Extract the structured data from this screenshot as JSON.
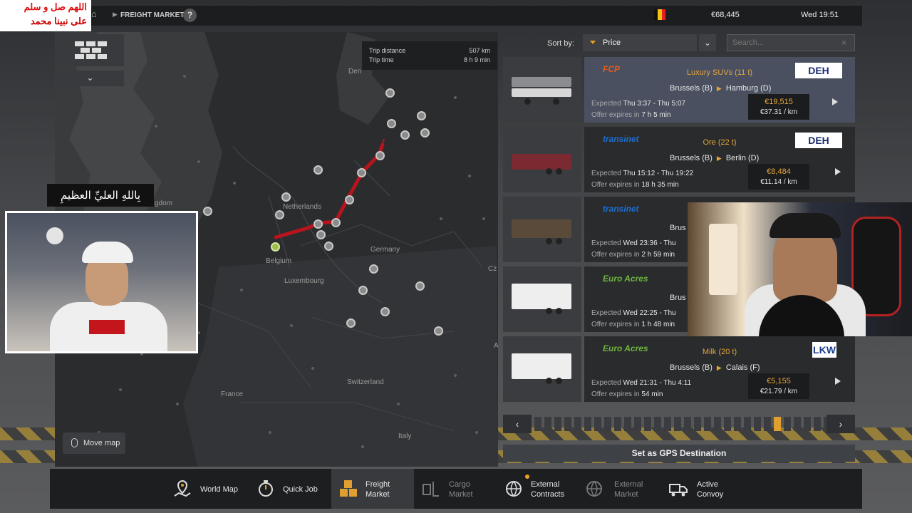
{
  "header": {
    "breadcrumb": "FREIGHT MARKET",
    "help": "?",
    "money": "€68,445",
    "clock": "Wed 19:51",
    "flag_colors": [
      "#111111",
      "#f3c30c",
      "#e61e25"
    ]
  },
  "overlay": {
    "arabic_line1": "اللهم صل و سلم",
    "arabic_line2": "على نبينا محمد",
    "caption": "بِاللهِ العليِّ العظيمِ"
  },
  "map": {
    "trip_distance_label": "Trip distance",
    "trip_distance_value": "507 km",
    "trip_time_label": "Trip time",
    "trip_time_value": "8 h 9 min",
    "labels": [
      "Den",
      "gdom",
      "Netherlands",
      "Belgium",
      "Luxembourg",
      "Germany",
      "Cz",
      "France",
      "Switzerland",
      "Italy",
      "A"
    ],
    "move_map": "Move map",
    "route_color": "#b8141e"
  },
  "sort": {
    "label": "Sort by:",
    "value": "Price",
    "search_placeholder": "Search..."
  },
  "jobs": [
    {
      "company": "FCP",
      "cargo": "Luxury SUVs (11 t)",
      "from": "Brussels (B)",
      "to": "Hamburg (D)",
      "expected_label": "Expected",
      "expected": "Thu 3:37 - Thu 5:07",
      "offer_label": "Offer expires in",
      "offer": "7 h 5 min",
      "price": "€19,515",
      "per_km": "€37.31 / km",
      "client": "DEH",
      "company_color": "#e85a16"
    },
    {
      "company": "transinet",
      "cargo": "Ore (22 t)",
      "from": "Brussels (B)",
      "to": "Berlin (D)",
      "expected_label": "Expected",
      "expected": "Thu 15:12 - Thu 19:22",
      "offer_label": "Offer expires in",
      "offer": "18 h 35 min",
      "price": "€8,484",
      "per_km": "€11.14 / km",
      "client": "DEH",
      "company_color": "#1d6fd0"
    },
    {
      "company": "transinet",
      "cargo": "",
      "from": "Brus",
      "to": "",
      "expected_label": "Expected",
      "expected": "Wed 23:36 - Thu",
      "offer_label": "Offer expires in",
      "offer": "2 h 59 min",
      "price": "",
      "per_km": "",
      "client": "",
      "company_color": "#1d6fd0"
    },
    {
      "company": "Euro Acres",
      "cargo": "",
      "from": "Brus",
      "to": "",
      "expected_label": "Expected",
      "expected": "Wed 22:25 - Thu",
      "offer_label": "Offer expires in",
      "offer": "1 h 48 min",
      "price": "",
      "per_km": "",
      "client": "",
      "company_color": "#6db33f"
    },
    {
      "company": "Euro Acres",
      "cargo": "Milk (20 t)",
      "from": "Brussels (B)",
      "to": "Calais (F)",
      "expected_label": "Expected",
      "expected": "Wed 21:31 - Thu 4:11",
      "offer_label": "Offer expires in",
      "offer": "54 min",
      "price": "€5,155",
      "per_km": "€21.79 / km",
      "client": "LKW",
      "company_color": "#6db33f"
    }
  ],
  "pager": {
    "prev": "‹",
    "next": "›",
    "active_index": 12
  },
  "gps_button": "Set as GPS Destination",
  "nav": [
    {
      "label1": "World Map",
      "label2": ""
    },
    {
      "label1": "Quick Job",
      "label2": ""
    },
    {
      "label1": "Freight",
      "label2": "Market"
    },
    {
      "label1": "Cargo",
      "label2": "Market"
    },
    {
      "label1": "External",
      "label2": "Contracts"
    },
    {
      "label1": "External",
      "label2": "Market"
    },
    {
      "label1": "Active",
      "label2": "Convoy"
    }
  ]
}
